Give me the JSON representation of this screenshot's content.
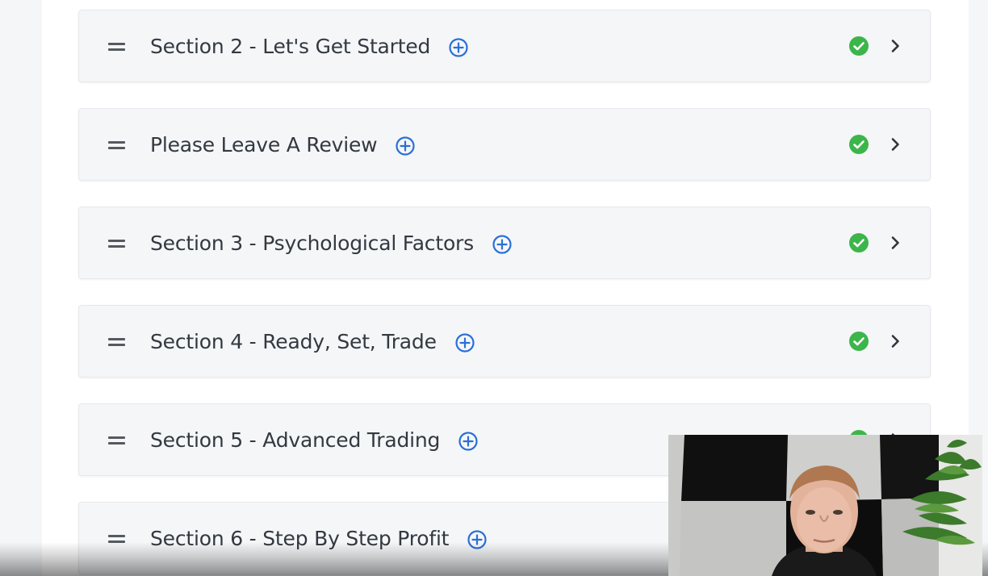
{
  "sections": [
    {
      "title": "Section 2 - Let's Get Started",
      "completed": true
    },
    {
      "title": "Please Leave A Review",
      "completed": true
    },
    {
      "title": "Section 3 - Psychological Factors",
      "completed": true
    },
    {
      "title": "Section 4 - Ready, Set, Trade",
      "completed": true
    },
    {
      "title": "Section 5 - Advanced Trading",
      "completed": true
    },
    {
      "title": "Section 6 - Step By Step Profit",
      "completed": true
    }
  ],
  "icons": {
    "drag": "drag-handle-icon",
    "add": "add-circle-icon",
    "complete": "check-circle-icon",
    "expand": "chevron-right-icon"
  },
  "colors": {
    "accent_blue": "#2b6fd6",
    "success_green": "#3cb54a",
    "row_background": "#f4f6f8",
    "text": "#333940"
  }
}
